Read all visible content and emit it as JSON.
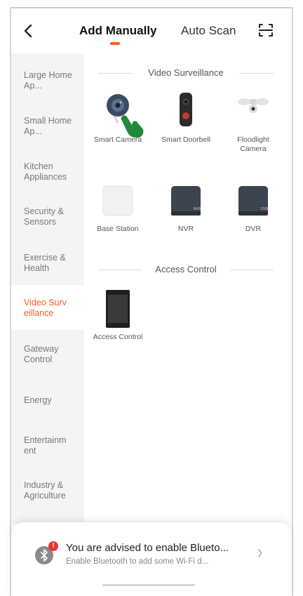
{
  "header": {
    "tabs": [
      "Add Manually",
      "Auto Scan"
    ],
    "active_tab": "Add Manually",
    "accent_color": "#ff5a1f"
  },
  "sidebar": {
    "items": [
      {
        "label": "Large Home Ap..."
      },
      {
        "label": "Small Home Ap..."
      },
      {
        "label": "Kitchen Appliances"
      },
      {
        "label": "Security & Sensors"
      },
      {
        "label": "Exercise & Health"
      },
      {
        "label": "Video Surv eillance"
      },
      {
        "label": "Gateway Control"
      },
      {
        "label": "Energy"
      },
      {
        "label": "Entertainm ent"
      },
      {
        "label": "Industry & Agriculture"
      }
    ],
    "active_item": "Video Surv eillance"
  },
  "sections": {
    "video_surveillance": {
      "title": "Video Surveillance",
      "devices": [
        {
          "label": "Smart Camera",
          "icon": "smart-camera-icon"
        },
        {
          "label": "Smart Doorbell",
          "icon": "smart-doorbell-icon"
        },
        {
          "label": "Floodlight Camera",
          "icon": "floodlight-camera-icon"
        },
        {
          "label": "Base Station",
          "icon": "base-station-icon"
        },
        {
          "label": "NVR",
          "icon": "nvr-icon",
          "badge": "NVR"
        },
        {
          "label": "DVR",
          "icon": "dvr-icon",
          "badge": "DVR"
        }
      ]
    },
    "access_control": {
      "title": "Access Control",
      "devices": [
        {
          "label": "Access Control",
          "icon": "access-control-icon"
        }
      ]
    }
  },
  "bluetooth_sheet": {
    "title": "You are advised to enable Blueto...",
    "subtitle": "Enable Bluetooth to add some Wi-Fi d...",
    "badge": "!",
    "badge_color": "#e8332d"
  }
}
